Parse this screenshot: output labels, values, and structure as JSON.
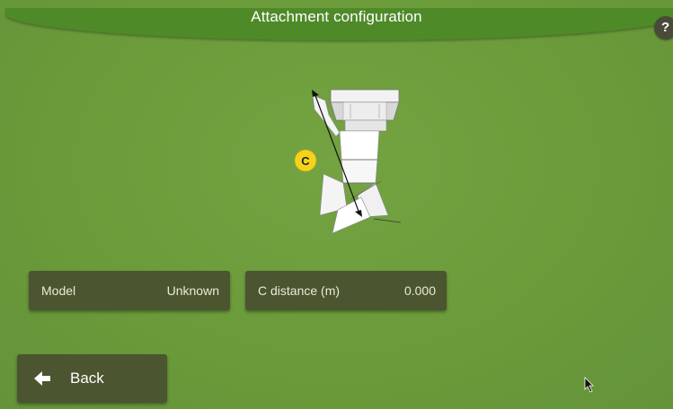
{
  "header": {
    "title": "Attachment configuration",
    "help_label": "?"
  },
  "diagram": {
    "marker_label": "C"
  },
  "fields": [
    {
      "label": "Model",
      "value": "Unknown"
    },
    {
      "label": "C distance (m)",
      "value": "0.000"
    }
  ],
  "footer": {
    "back_label": "Back"
  },
  "icons": {
    "back": "arrow-left-icon",
    "help": "question-mark-icon",
    "cursor": "mouse-pointer-icon"
  },
  "colors": {
    "background": "#6a9a39",
    "title_bar": "#4f8a29",
    "panel": "#4b5530",
    "marker": "#f5d21e"
  }
}
